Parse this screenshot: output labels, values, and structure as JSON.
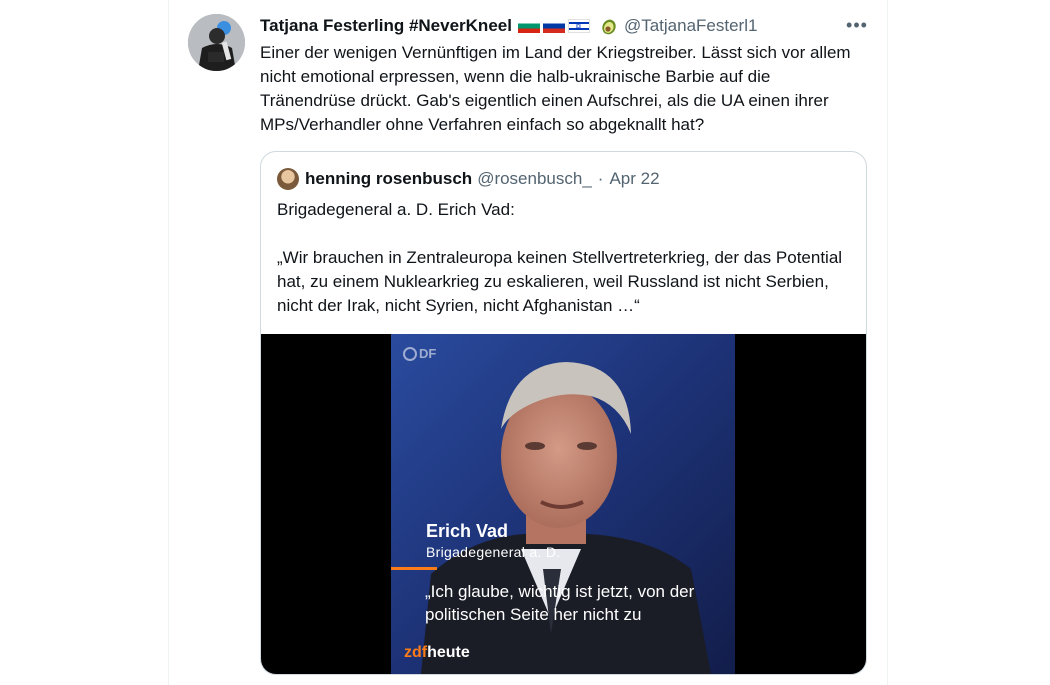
{
  "tweet": {
    "display_name": "Tatjana Festerling #NeverKneel",
    "handle": "@TatjanaFesterl1",
    "more_label": "•••",
    "text": "Einer der wenigen Vernünftigen im Land der Kriegstreiber. Lässt sich vor allem nicht emotional erpressen, wenn die halb-ukrainische Barbie auf die Tränendrüse drückt. Gab's eigentlich einen Aufschrei, als die UA einen ihrer MPs/Verhandler ohne Verfahren einfach so abgeknallt hat?",
    "emoji_icons": [
      "flag-bulgaria-icon",
      "flag-russia-icon",
      "flag-israel-icon",
      "avocado-icon"
    ]
  },
  "quote": {
    "display_name": "henning rosenbusch",
    "handle": "@rosenbusch_",
    "separator": "·",
    "date": "Apr 22",
    "text": "Brigadegeneral a. D. Erich Vad:\n\n„Wir brauchen in Zentraleuropa keinen Stellvertreterkrieg, der das Potential hat, zu einem Nuklearkrieg zu eskalieren, weil Russland ist nicht Serbien, nicht der Irak, nicht Syrien, nicht Afghanistan …“"
  },
  "video": {
    "watermark": "DF",
    "lower_third_name": "Erich Vad",
    "lower_third_title": "Brigadegeneral a. D.",
    "subtitle": "„Ich glaube, wichtig ist jetzt, von der politischen Seite her nicht zu",
    "brand_prefix": "zdf",
    "brand_suffix": "heute",
    "accent_color": "#fa7d19"
  }
}
